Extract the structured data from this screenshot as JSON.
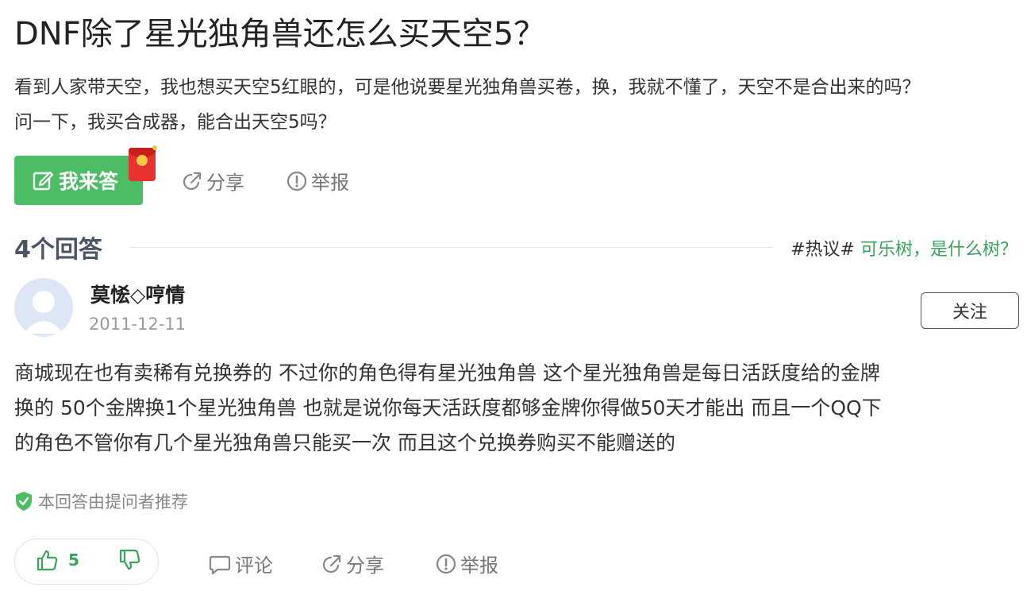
{
  "question": {
    "title": "DNF除了星光独角兽还怎么买天空5？",
    "description_lines": [
      "看到人家带天空，我也想买天空5红眼的，可是他说要星光独角兽买卷，换，我就不懂了，天空不是合出来的吗？",
      "问一下，我买合成器，能合出天空5吗？"
    ]
  },
  "actions": {
    "answer_label": "我来答",
    "share_label": "分享",
    "report_label": "举报"
  },
  "answers_header": {
    "count_label": "4个回答",
    "hot_tag": "#热议#",
    "hot_topic": "可乐树，是什么树？"
  },
  "answer": {
    "username": "莫恡◇哼情",
    "date": "2011-12-11",
    "follow_label": "关注",
    "content_lines": [
      "商城现在也有卖稀有兑换券的 不过你的角色得有星光独角兽 这个星光独角兽是每日活跃度给的金牌",
      "换的 50个金牌换1个星光独角兽 也就是说你每天活跃度都够金牌你得做50天才能出 而且一个QQ下",
      "的角色不管你有几个星光独角兽只能买一次 而且这个兑换券购买不能赠送的"
    ],
    "recommend_text": "本回答由提问者推荐",
    "upvotes": "5",
    "comment_label": "评论",
    "share_label": "分享",
    "report_label": "举报"
  },
  "colors": {
    "accent_green": "#4cbd64",
    "topic_green": "#3aa25b",
    "count_color": "#4a5566"
  }
}
